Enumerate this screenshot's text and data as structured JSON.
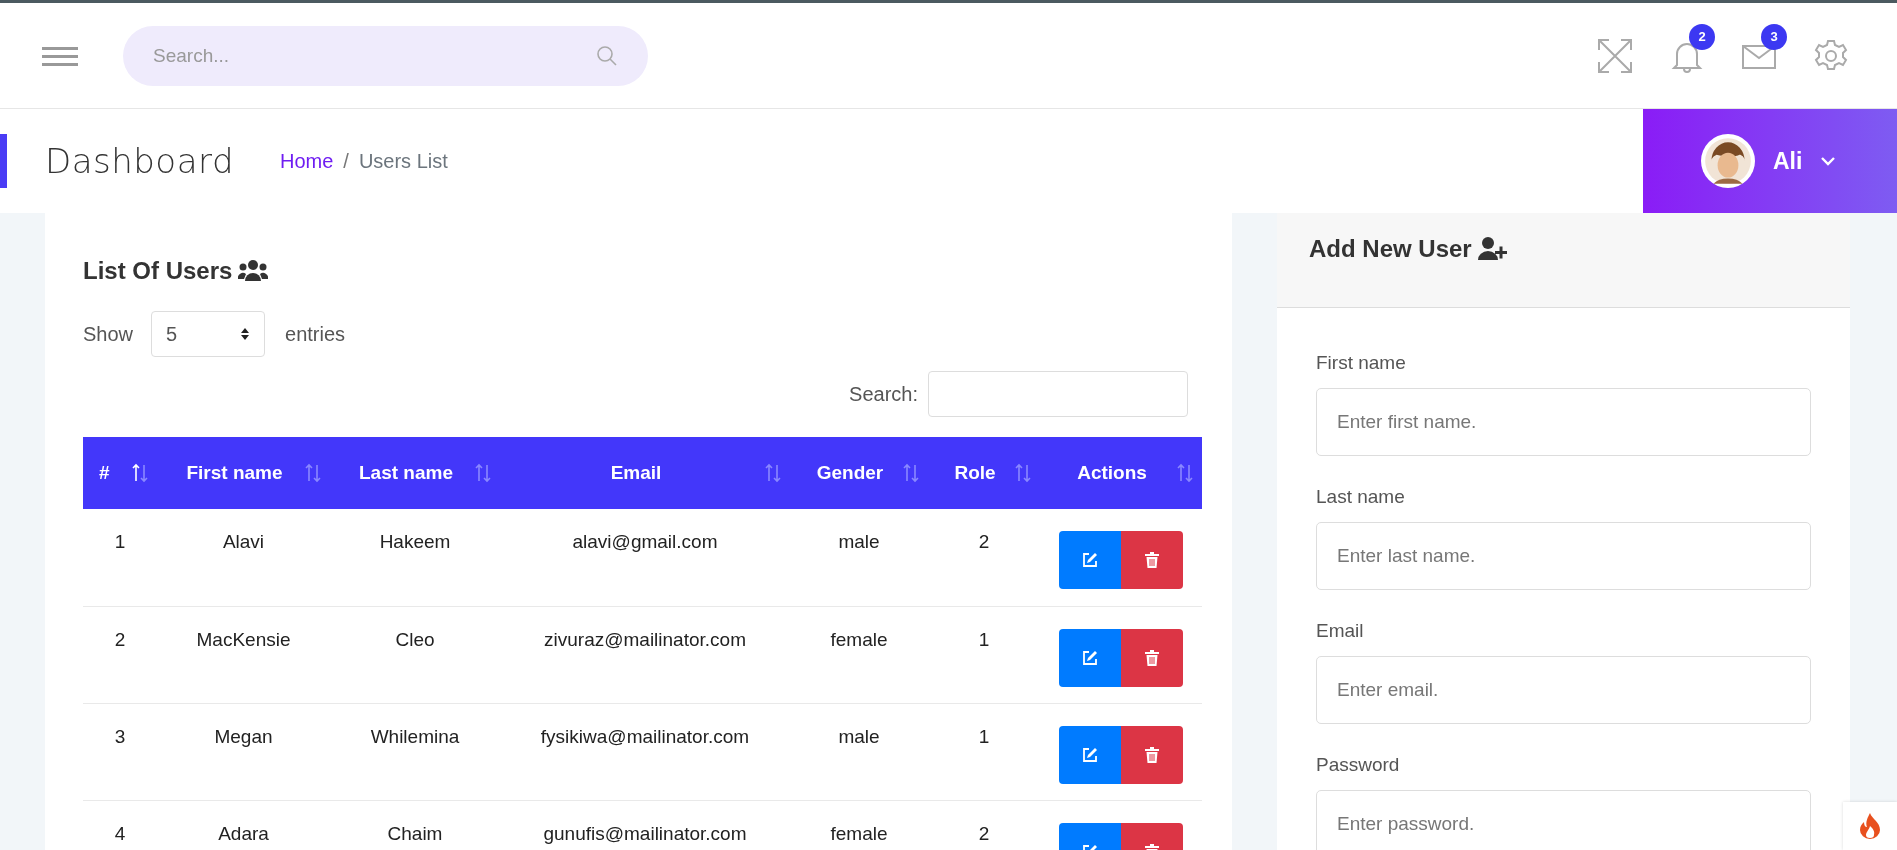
{
  "topbar": {
    "search": {
      "placeholder": "Search..."
    },
    "notifications": {
      "badge": "2"
    },
    "messages": {
      "badge": "3"
    }
  },
  "header": {
    "title": "Dashboard",
    "breadcrumb_separator": "/",
    "breadcrumb": [
      {
        "label": "Home",
        "link": true
      },
      {
        "label": "Users List",
        "link": false
      }
    ],
    "user": {
      "name": "Ali"
    }
  },
  "users_card": {
    "title": "List Of Users",
    "show_label": "Show",
    "page_size": "5",
    "entries_label": "entries",
    "search_label": "Search:",
    "columns": [
      {
        "label": "#",
        "sorted": true
      },
      {
        "label": "First name",
        "sorted": false
      },
      {
        "label": "Last name",
        "sorted": false
      },
      {
        "label": "Email",
        "sorted": false
      },
      {
        "label": "Gender",
        "sorted": false
      },
      {
        "label": "Role",
        "sorted": false
      },
      {
        "label": "Actions",
        "sorted": false
      }
    ],
    "rows": [
      {
        "cells": [
          "1",
          "Alavi",
          "Hakeem",
          "alavi@gmail.com",
          "male",
          "2"
        ]
      },
      {
        "cells": [
          "2",
          "MacKensie",
          "Cleo",
          "zivuraz@mailinator.com",
          "female",
          "1"
        ]
      },
      {
        "cells": [
          "3",
          "Megan",
          "Whilemina",
          "fysikiwa@mailinator.com",
          "male",
          "1"
        ]
      },
      {
        "cells": [
          "4",
          "Adara",
          "Chaim",
          "gunufis@mailinator.com",
          "female",
          "2"
        ]
      }
    ]
  },
  "add_user_card": {
    "title": "Add New User",
    "fields": [
      {
        "label": "First name",
        "placeholder": "Enter first name."
      },
      {
        "label": "Last name",
        "placeholder": "Enter last name."
      },
      {
        "label": "Email",
        "placeholder": "Enter email."
      },
      {
        "label": "Password",
        "placeholder": "Enter password."
      }
    ]
  }
}
